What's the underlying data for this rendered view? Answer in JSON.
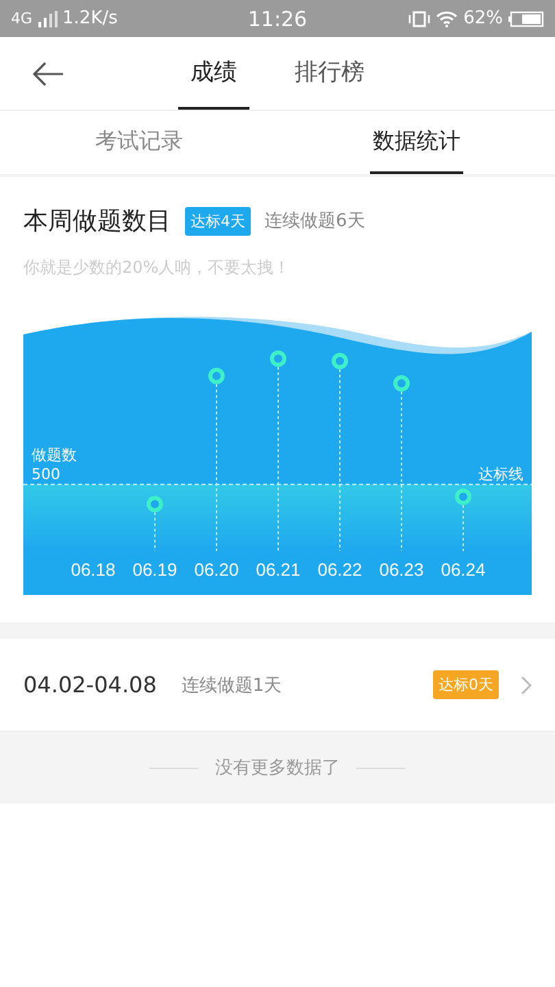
{
  "status_bar": {
    "network": "4G",
    "speed": "1.2K/s",
    "time": "11:26",
    "battery": "62%"
  },
  "tabs": [
    {
      "label": "成绩",
      "selected": true
    },
    {
      "label": "排行榜",
      "selected": false
    }
  ],
  "subtabs": [
    {
      "label": "考试记录",
      "selected": false
    },
    {
      "label": "数据统计",
      "selected": true
    }
  ],
  "week": {
    "title": "本周做题数目",
    "badge": "达标4天",
    "streak": "连续做题6天",
    "note": "你就是少数的20%人呐，不要太拽！",
    "chart": {
      "y_label": "做题数",
      "threshold_value": "500",
      "threshold_label": "达标线",
      "days": [
        {
          "label": "06.18"
        },
        {
          "label": "06.19"
        },
        {
          "label": "06.20"
        },
        {
          "label": "06.21"
        },
        {
          "label": "06.22"
        },
        {
          "label": "06.23"
        },
        {
          "label": "06.24"
        }
      ]
    }
  },
  "history": [
    {
      "range": "04.02-04.08",
      "streak": "连续做题1天",
      "badge": "达标0天"
    }
  ],
  "footer": "没有更多数据了"
}
